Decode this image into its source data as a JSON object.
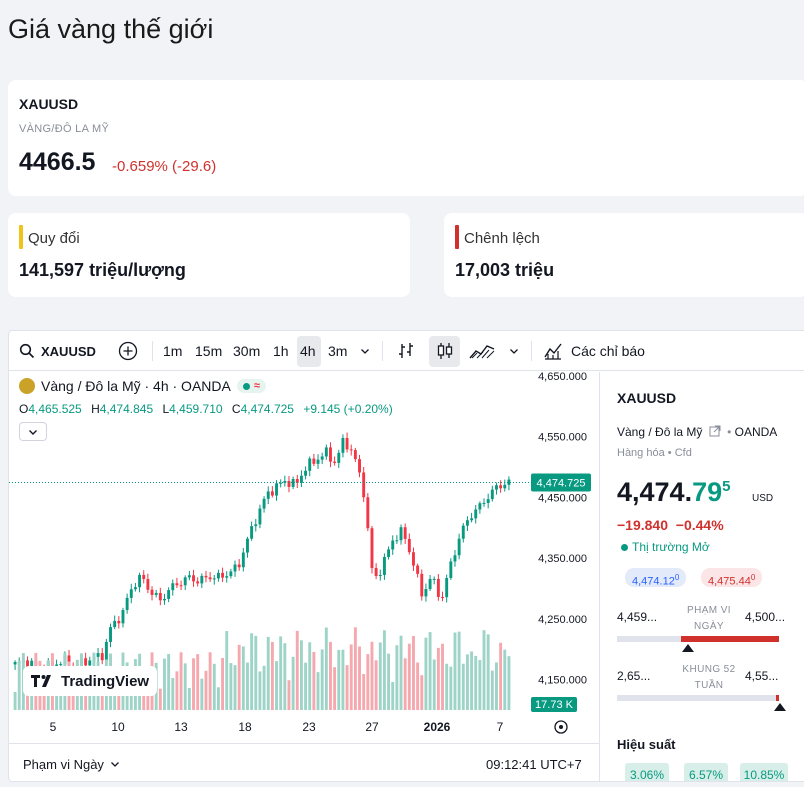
{
  "page_title": "Giá vàng thế giới",
  "quote": {
    "symbol": "XAUUSD",
    "subtitle": "VÀNG/ĐÔ LA MỸ",
    "price": "4466.5",
    "change": "-0.659% (-29.6)",
    "change_color": "#d0312d"
  },
  "cards": {
    "quydoi": {
      "label": "Quy đổi",
      "value": "141,597 triệu/lượng",
      "accent": "#f0c419"
    },
    "chenhlech": {
      "label": "Chênh lệch",
      "value": "17,003 triệu",
      "accent": "#d0312d"
    }
  },
  "toolbar": {
    "symbol": "XAUUSD",
    "intervals": [
      "1m",
      "15m",
      "30m",
      "1h",
      "4h",
      "3m"
    ],
    "active_interval": "4h",
    "indicators_label": "Các chỉ báo",
    "icons": [
      "search-icon",
      "add-compare-icon",
      "chevron-down-icon",
      "bar-style-icon",
      "candle-style-icon",
      "area-style-icon",
      "chevron-down-icon",
      "indicators-icon"
    ]
  },
  "legend": {
    "title": "Vàng / Đô la Mỹ · 4h · OANDA",
    "open_key": "O",
    "open": "4,465.525",
    "high_key": "H",
    "high": "4,474.845",
    "low_key": "L",
    "low": "4,459.710",
    "close_key": "C",
    "close": "4,474.725",
    "change": "+9.145 (+0.20%)"
  },
  "chart": {
    "price_ticks": [
      "4,650.000",
      "4,550.000",
      "4,450.000",
      "4,350.000",
      "4,250.000",
      "4,150.000"
    ],
    "last_price_label": "4,474.725",
    "volume_label": "17.73 K",
    "date_ticks": [
      "5",
      "10",
      "13",
      "18",
      "23",
      "27",
      "2026",
      "7"
    ],
    "up_color": "#089981",
    "down_color": "#f23645"
  },
  "chart_data": {
    "type": "candlestick",
    "ylim": [
      4100,
      4650
    ],
    "x_ticks": [
      "5",
      "10",
      "13",
      "18",
      "23",
      "27",
      "2026",
      "7"
    ],
    "close_path": [
      4175,
      4180,
      4172,
      4168,
      4175,
      4182,
      4170,
      4178,
      4185,
      4190,
      4240,
      4255,
      4300,
      4320,
      4295,
      4280,
      4300,
      4310,
      4318,
      4312,
      4320,
      4318,
      4325,
      4335,
      4380,
      4420,
      4455,
      4468,
      4478,
      4470,
      4500,
      4510,
      4525,
      4508,
      4545,
      4520,
      4460,
      4310,
      4340,
      4380,
      4395,
      4350,
      4290,
      4320,
      4280,
      4340,
      4390,
      4420,
      4435,
      4455,
      4470,
      4474.725
    ]
  },
  "tradingview_label": "TradingView",
  "bottom": {
    "range_label": "Phạm vi Ngày",
    "time": "09:12:41 UTC+7"
  },
  "side": {
    "symbol": "XAUUSD",
    "name": "Vàng / Đô la Mỹ",
    "exchange": "OANDA",
    "category": "Hàng hóa",
    "type": "Cfd",
    "price_main": "4,474.",
    "price_frac": "79",
    "price_sup": "5",
    "currency": "USD",
    "change": "−19.840",
    "change_pct": "−0.44%",
    "market_status": "Thị trường Mở",
    "bid": "4,474.12",
    "bid_sup": "0",
    "ask": "4,475.44",
    "ask_sup": "0",
    "day_low": "4,459...",
    "day_label": "PHẠM VI NGÀY",
    "day_high": "4,500...",
    "week_low": "2,65...",
    "week_label": "KHUNG 52 TUẦN",
    "week_high": "4,55...",
    "perf_title": "Hiệu suất",
    "perf": [
      "3.06%",
      "6.57%",
      "10.85%"
    ]
  }
}
